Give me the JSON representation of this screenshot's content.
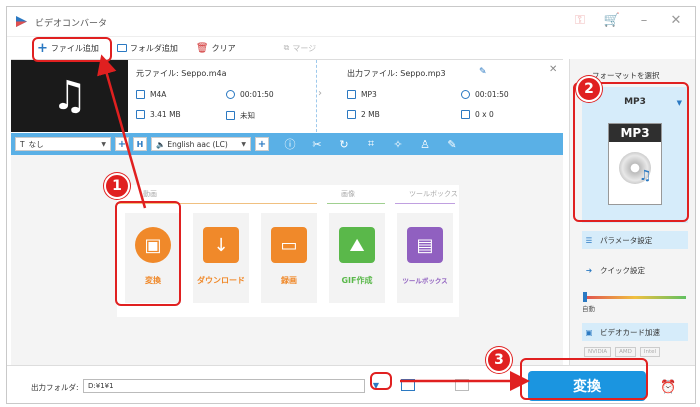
{
  "window": {
    "title": "ビデオコンバータ",
    "icons": [
      "key-icon",
      "cart-icon",
      "minimize-icon",
      "close-icon"
    ]
  },
  "toolbar": {
    "add_file": "ファイル追加",
    "add_folder": "フォルダ追加",
    "clear": "クリア",
    "merge": "マージ"
  },
  "file": {
    "source_label": "元ファイル: Seppo.m4a",
    "output_label": "出力ファイル: Seppo.mp3",
    "src_format": "M4A",
    "src_duration": "00:01:50",
    "src_size": "3.41 MB",
    "src_resolution": "未知",
    "out_format": "MP3",
    "out_duration": "00:01:50",
    "out_size": "2 MB",
    "out_resolution": "0 x 0"
  },
  "editbar": {
    "subtitle": "なし",
    "audio_track": "English aac (LC)"
  },
  "tools": {
    "cat_video": "動画",
    "cat_image": "画像",
    "cat_toolbox": "ツールボックス",
    "items": [
      {
        "label": "変換",
        "color": "#f0892a"
      },
      {
        "label": "ダウンロード",
        "color": "#f0892a"
      },
      {
        "label": "録画",
        "color": "#f0892a"
      },
      {
        "label": "GIF作成",
        "color": "#5ab84a"
      },
      {
        "label": "ツールボックス",
        "color": "#9060c0"
      }
    ]
  },
  "right_panel": {
    "format_title": "フォーマットを選択",
    "format_name": "MP3",
    "format_icon_text": "MP3",
    "param_settings": "パラメータ設定",
    "quick_settings": "クイック設定",
    "auto_label": "自動",
    "gpu_accel": "ビデオカード加速",
    "gpu_brands": [
      "NVIDIA",
      "AMD",
      "Intel"
    ]
  },
  "footer": {
    "output_folder_label": "出力フォルダ:",
    "output_folder_value": "D:¥1¥1",
    "convert": "変換"
  },
  "annotations": {
    "step1": "1",
    "step2": "2",
    "step3": "3",
    "color": "#e02020"
  }
}
